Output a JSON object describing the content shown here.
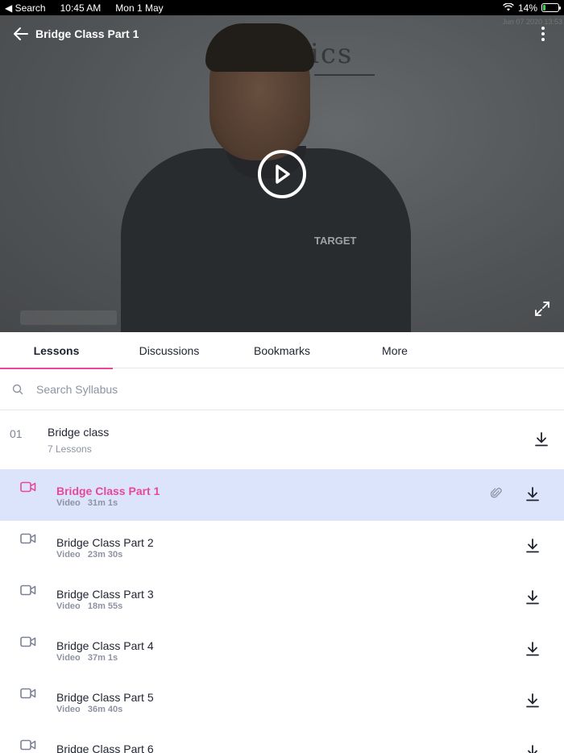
{
  "status_bar": {
    "back_app": "Search",
    "time": "10:45 AM",
    "date": "Mon 1 May",
    "battery": "14%",
    "battery_level": 0.14
  },
  "video": {
    "title": "Bridge Class Part 1",
    "date_stamp": "Jun 07 2020 13:53",
    "board_text": "ics",
    "shirt_logo": "TARGET"
  },
  "tabs": [
    {
      "label": "Lessons",
      "active": true
    },
    {
      "label": "Discussions",
      "active": false
    },
    {
      "label": "Bookmarks",
      "active": false
    },
    {
      "label": "More",
      "active": false
    }
  ],
  "search": {
    "placeholder": "Search Syllabus"
  },
  "section": {
    "number": "01",
    "title": "Bridge class",
    "subtitle": "7 Lessons"
  },
  "lessons": [
    {
      "title": "Bridge Class Part 1",
      "type": "Video",
      "duration": "31m 1s",
      "active": true
    },
    {
      "title": "Bridge Class Part 2",
      "type": "Video",
      "duration": "23m 30s",
      "active": false
    },
    {
      "title": "Bridge Class Part 3",
      "type": "Video",
      "duration": "18m 55s",
      "active": false
    },
    {
      "title": "Bridge Class Part 4",
      "type": "Video",
      "duration": "37m 1s",
      "active": false
    },
    {
      "title": "Bridge Class Part 5",
      "type": "Video",
      "duration": "36m 40s",
      "active": false
    },
    {
      "title": "Bridge Class Part 6",
      "type": "",
      "duration": "",
      "active": false
    }
  ],
  "colors": {
    "accent": "#e9479b",
    "active_row": "#dbe4fb",
    "text": "#1f2430",
    "muted": "#8d93a3",
    "camera_icon": "#7b8296"
  }
}
